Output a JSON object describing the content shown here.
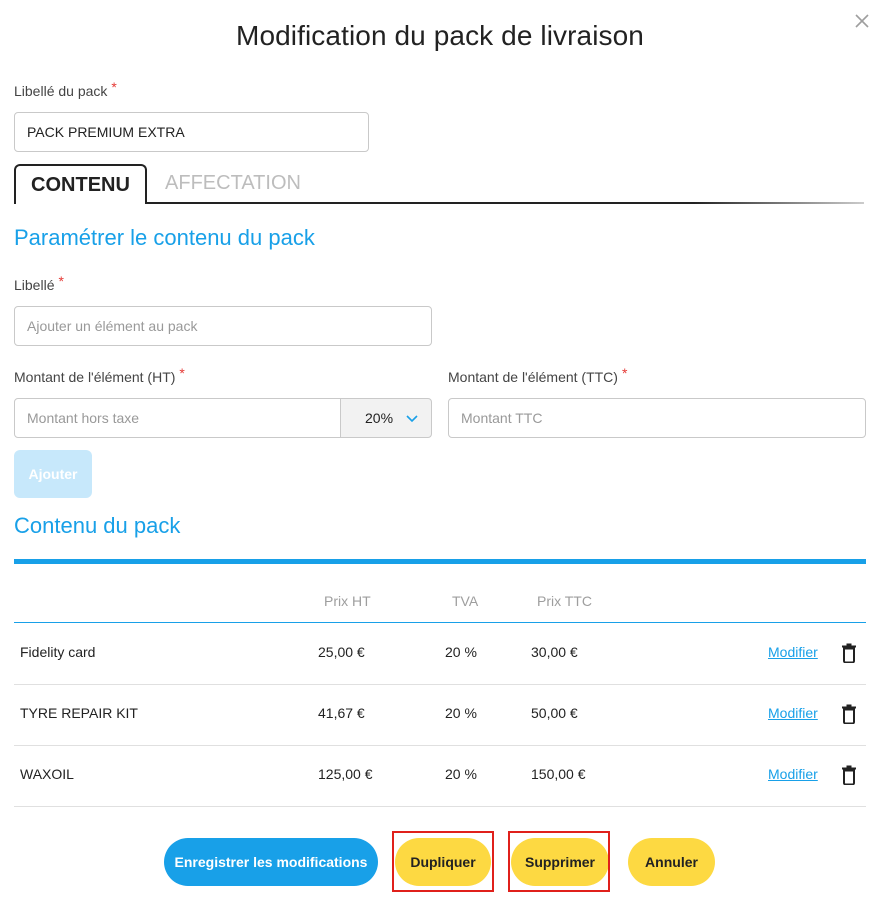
{
  "modal": {
    "title": "Modification du pack de livraison",
    "close_icon": "close-icon"
  },
  "pack": {
    "label": "Libellé du pack",
    "required_mark": "*",
    "value": "PACK PREMIUM EXTRA"
  },
  "tabs": [
    {
      "label": "CONTENU",
      "active": true
    },
    {
      "label": "AFFECTATION",
      "active": false
    }
  ],
  "content_settings": {
    "title": "Paramétrer le contenu du pack",
    "libelle_label": "Libellé",
    "libelle_placeholder": "Ajouter un élément au pack",
    "ht_label": "Montant de l'élément (HT)",
    "ht_placeholder": "Montant hors taxe",
    "vat_selected": "20%",
    "ttc_label": "Montant de l'élément (TTC)",
    "ttc_placeholder": "Montant TTC",
    "add_button": "Ajouter"
  },
  "pack_content": {
    "title": "Contenu du pack",
    "columns": [
      "Prix HT",
      "TVA",
      "Prix TTC"
    ],
    "rows": [
      {
        "name": "Fidelity card",
        "ht": "25,00 €",
        "tva": "20 %",
        "ttc": "30,00 €",
        "action": "Modifier"
      },
      {
        "name": "TYRE REPAIR KIT",
        "ht": "41,67 €",
        "tva": "20 %",
        "ttc": "50,00 €",
        "action": "Modifier"
      },
      {
        "name": "WAXOIL",
        "ht": "125,00 €",
        "tva": "20 %",
        "ttc": "150,00 €",
        "action": "Modifier"
      }
    ]
  },
  "footer": {
    "save": "Enregistrer les modifications",
    "duplicate": "Dupliquer",
    "delete": "Supprimer",
    "cancel": "Annuler"
  },
  "colors": {
    "accent": "#18a0e8",
    "yellow": "#fdd942",
    "required": "#e53935",
    "highlight": "#e0201b"
  }
}
